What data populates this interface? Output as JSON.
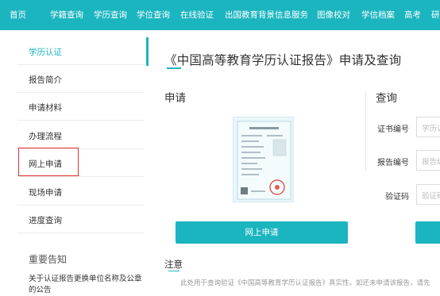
{
  "nav": {
    "items": [
      "首页",
      "学籍查询",
      "学历查询",
      "学位查询",
      "在线验证",
      "出国教育背景信息服务",
      "图像校对",
      "学信档案",
      "高考",
      "研"
    ]
  },
  "sidebar": {
    "items": [
      {
        "label": "学历认证"
      },
      {
        "label": "报告简介"
      },
      {
        "label": "申请材料"
      },
      {
        "label": "办理流程"
      },
      {
        "label": "网上申请"
      },
      {
        "label": "现场申请"
      },
      {
        "label": "进度查询"
      }
    ],
    "notice_title": "重要告知",
    "notice_item": "关于认证报告更换单位名称及公章的公告"
  },
  "main": {
    "title": "《中国高等教育学历认证报告》申请及查询",
    "apply_title": "申请",
    "query_title": "查询",
    "apply_button": "网上申请",
    "fields": [
      {
        "label": "证书编号",
        "placeholder": "学历证"
      },
      {
        "label": "报告编号",
        "placeholder": "报告编"
      },
      {
        "label": "验证码",
        "placeholder": "验证码"
      }
    ],
    "note_title": "注意",
    "note_text": "此处用于查询验证《中国高等教育学历认证报告》真实性。如还未申请该报告，请先"
  },
  "colors": {
    "accent": "#1bb5c0",
    "highlight": "#e0322d"
  }
}
